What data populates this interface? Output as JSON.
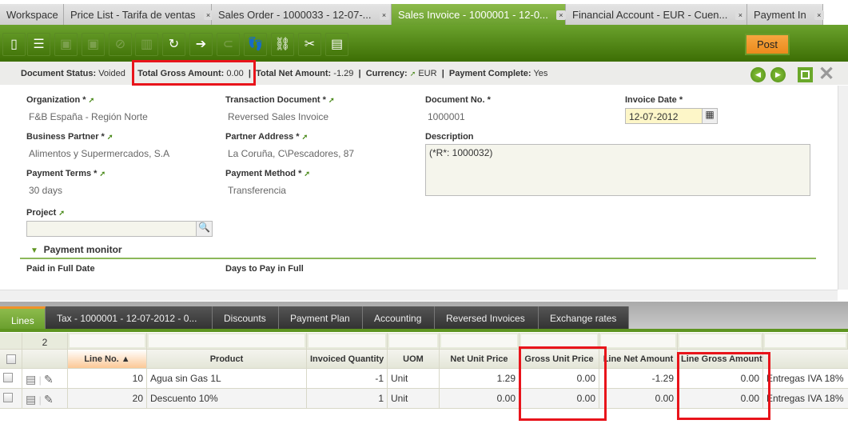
{
  "tabs": [
    {
      "label": "Workspace",
      "closable": false
    },
    {
      "label": "Price List - Tarifa de ventas",
      "closable": true
    },
    {
      "label": "Sales Order - 1000033 - 12-07-...",
      "closable": true
    },
    {
      "label": "Sales Invoice - 1000001 - 12-0...",
      "closable": true,
      "active": true
    },
    {
      "label": "Financial Account - EUR - Cuen...",
      "closable": true
    },
    {
      "label": "Payment In",
      "closable": true
    }
  ],
  "close_glyph": "×",
  "toolbar": {
    "icons": [
      "new-document-icon",
      "new-row-icon",
      "save-icon",
      "save-close-icon",
      "undo-icon",
      "delete-icon",
      "refresh-icon",
      "export-icon",
      "attachment-icon",
      "audit-trail-icon",
      "link-icon",
      "tree-tools-icon",
      "grid-view-icon"
    ],
    "post_label": "Post"
  },
  "status": {
    "document_status_label": "Document Status:",
    "document_status": "Voided",
    "total_gross_label": "Total Gross Amount:",
    "total_gross": "0.00",
    "total_net_label": "Total Net Amount:",
    "total_net": "-1.29",
    "currency_label": "Currency:",
    "currency": "EUR",
    "payment_complete_label": "Payment Complete:",
    "payment_complete": "Yes",
    "sep": "|"
  },
  "form": {
    "organization_label": "Organization *",
    "organization": "F&B España - Región Norte",
    "transaction_doc_label": "Transaction Document *",
    "transaction_doc": "Reversed Sales Invoice",
    "document_no_label": "Document No. *",
    "document_no": "1000001",
    "invoice_date_label": "Invoice Date *",
    "invoice_date": "12-07-2012",
    "business_partner_label": "Business Partner *",
    "business_partner": "Alimentos y Supermercados, S.A",
    "partner_address_label": "Partner Address *",
    "partner_address": "La Coruña, C\\Pescadores, 87",
    "description_label": "Description",
    "description": "(*R*: 1000032)",
    "payment_terms_label": "Payment Terms *",
    "payment_terms": "30 days",
    "payment_method_label": "Payment Method *",
    "payment_method": "Transferencia",
    "project_label": "Project",
    "project": "",
    "payment_monitor_label": "Payment monitor",
    "paid_full_date_label": "Paid in Full Date",
    "days_to_pay_label": "Days to Pay in Full"
  },
  "subtabs": [
    "Lines",
    "Tax - 1000001 - 12-07-2012 - 0...",
    "Discounts",
    "Payment Plan",
    "Accounting",
    "Reversed Invoices",
    "Exchange rates"
  ],
  "grid": {
    "record_count": "2",
    "columns": [
      "Line No.",
      "Product",
      "Invoiced Quantity",
      "UOM",
      "Net Unit Price",
      "Gross Unit Price",
      "Line Net Amount",
      "Line Gross Amount",
      ""
    ],
    "sort_indicator": "▲",
    "rows": [
      [
        "10",
        "Agua sin Gas 1L",
        "-1",
        "Unit",
        "1.29",
        "0.00",
        "-1.29",
        "0.00",
        "Entregas IVA 18%"
      ],
      [
        "20",
        "Descuento 10%",
        "1",
        "Unit",
        "0.00",
        "0.00",
        "0.00",
        "0.00",
        "Entregas IVA 18%"
      ]
    ]
  },
  "colors": {
    "accent_green": "#6a9f2e",
    "post_orange": "#ec8a1c",
    "highlight_red": "#e8141b"
  }
}
